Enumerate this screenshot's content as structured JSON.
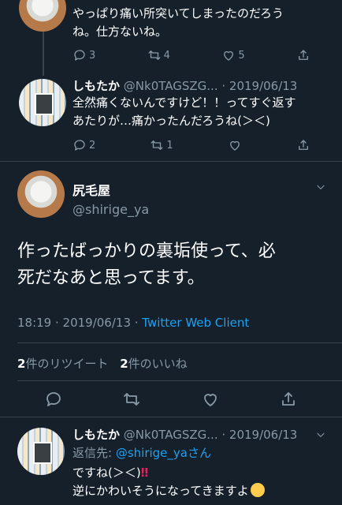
{
  "tweet1": {
    "text_line1": "やっぱり痛い所突いてしまったのだろう",
    "text_line2": "ね。仕方ないね。",
    "replies": "3",
    "retweets": "4",
    "likes": "5"
  },
  "tweet2": {
    "name": "しもたか",
    "handle_date": "@Nk0TAGSZG... · 2019/06/13",
    "text_line1": "全然痛くないんですけど！！ってすぐ返す",
    "text_line2": "あたりが…痛かったんだろうね(＞＜)",
    "replies": "2",
    "retweets": "1"
  },
  "main_tweet": {
    "name": "尻毛屋",
    "handle": "@shirige_ya",
    "text_line1": "作ったばっかりの裏垢使って、必",
    "text_line2": "死だなあと思ってます。",
    "time_date": "18:19 · 2019/06/13 · ",
    "client": "Twitter Web Client",
    "retweet_count": "2",
    "retweet_label": "件のリツイート",
    "like_count": "2",
    "like_label": "件のいいね"
  },
  "tweet3": {
    "name": "しもたか",
    "handle_date": "@Nk0TAGSZG... · 2019/06/13",
    "reply_to_prefix": "返信先: ",
    "reply_to_handle": "@shirige_ya",
    "reply_to_suffix": "さん",
    "text_line1": "ですね(＞＜)",
    "text_line2": "逆にかわいそうになってきますよ"
  },
  "icons": {
    "reply": "reply-icon",
    "retweet": "retweet-icon",
    "like": "heart-icon",
    "share": "share-icon",
    "more": "chevron-down-icon"
  },
  "colors": {
    "background": "#15202b",
    "muted": "#8899a6",
    "link": "#1da1f2",
    "divider": "#38444d"
  }
}
